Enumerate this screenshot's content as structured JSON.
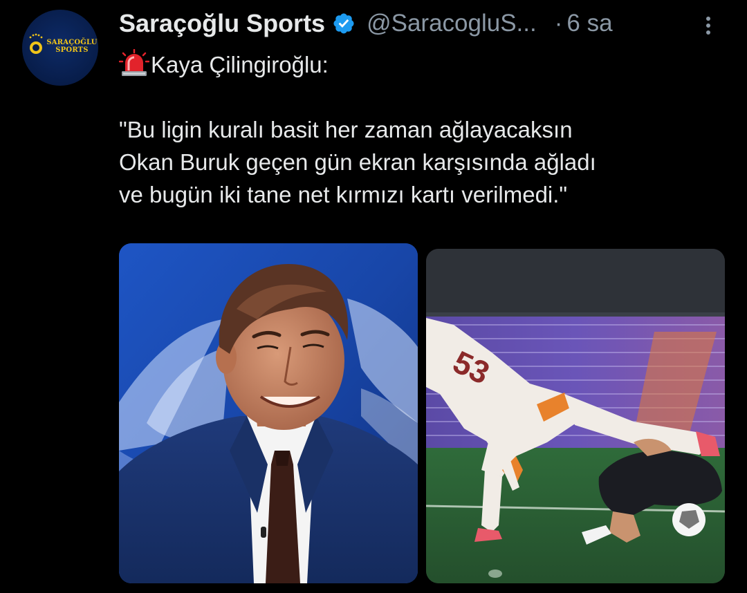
{
  "account": {
    "display_name": "Saraçoğlu Sports",
    "handle": "@SaracogluS...",
    "dot": "·",
    "time": "6 sa",
    "avatar_logo_text": [
      "SARAÇOĞLU",
      "SPORTS"
    ]
  },
  "tweet": {
    "lines": [
      "Kaya Çilingiroğlu:",
      "",
      "\"Bu ligin kuralı basit her zaman ağlayacaksın",
      "Okan Buruk geçen gün ekran karşısında ağladı",
      "ve bugün iki tane net kırmızı kartı verilmedi.\""
    ]
  },
  "icons": {
    "verified": "verified-badge-icon",
    "more": "more-vertical-icon",
    "siren": "rotating-light-icon"
  },
  "colors": {
    "background": "#000000",
    "text_primary": "#e7e9ea",
    "text_secondary": "#8b98a5",
    "verified_blue": "#1d9bf0",
    "avatar_navy": "#081d4a",
    "avatar_gold": "#f0c419"
  }
}
